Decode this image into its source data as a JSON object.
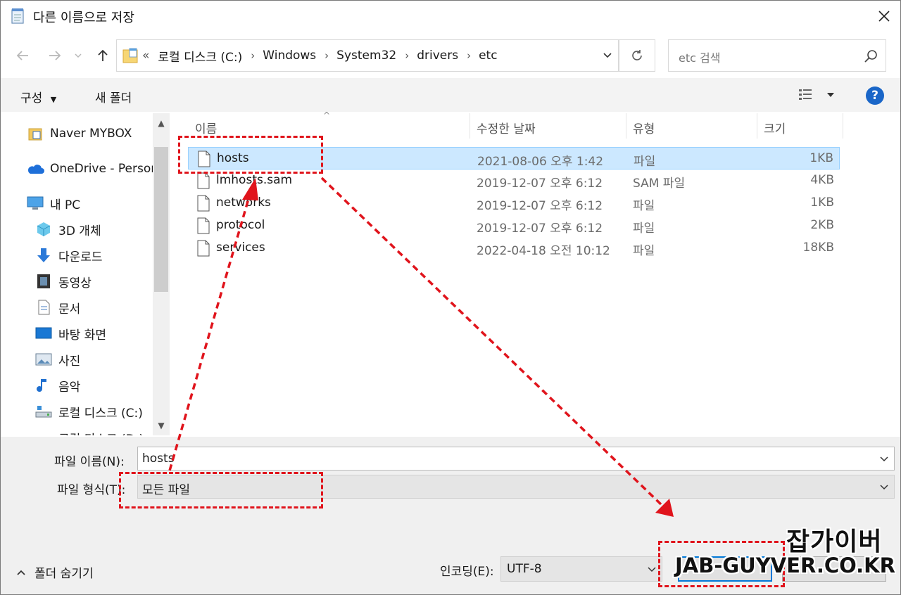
{
  "window": {
    "title": "다른 이름으로 저장"
  },
  "address": {
    "crumbs": [
      "«",
      "로컬 디스크 (C:)",
      "Windows",
      "System32",
      "drivers",
      "etc"
    ]
  },
  "search": {
    "placeholder": "etc 검색"
  },
  "commands": {
    "organize": "구성",
    "new_folder": "새 폴더"
  },
  "nav": {
    "items": [
      {
        "label": "Naver MYBOX",
        "icon": "naver-mybox-icon"
      },
      {
        "label": "OneDrive - Person",
        "icon": "onedrive-cloud-icon"
      },
      {
        "label": "내 PC",
        "icon": "pc-monitor-icon"
      },
      {
        "label": "3D 개체",
        "icon": "3d-object-icon"
      },
      {
        "label": "다운로드",
        "icon": "download-arrow-icon"
      },
      {
        "label": "동영상",
        "icon": "video-film-icon"
      },
      {
        "label": "문서",
        "icon": "document-icon"
      },
      {
        "label": "바탕 화면",
        "icon": "desktop-icon"
      },
      {
        "label": "사진",
        "icon": "picture-icon"
      },
      {
        "label": "음악",
        "icon": "music-note-icon"
      },
      {
        "label": "로컬 디스크 (C:)",
        "icon": "local-disk-icon"
      },
      {
        "label": "로컬 디스크 (D:)",
        "icon": "local-disk-icon"
      }
    ]
  },
  "list": {
    "columns": {
      "name": "이름",
      "date": "수정한 날짜",
      "type": "유형",
      "size": "크기"
    },
    "files": [
      {
        "name": "hosts",
        "date": "2021-08-06 오후 1:42",
        "type": "파일",
        "size": "1KB"
      },
      {
        "name": "lmhosts.sam",
        "date": "2019-12-07 오후 6:12",
        "type": "SAM 파일",
        "size": "4KB"
      },
      {
        "name": "networks",
        "date": "2019-12-07 오후 6:12",
        "type": "파일",
        "size": "1KB"
      },
      {
        "name": "protocol",
        "date": "2019-12-07 오후 6:12",
        "type": "파일",
        "size": "2KB"
      },
      {
        "name": "services",
        "date": "2022-04-18 오전 10:12",
        "type": "파일",
        "size": "18KB"
      }
    ]
  },
  "form": {
    "filename_label": "파일 이름(N):",
    "filename_value": "hosts",
    "filetype_label": "파일 형식(T):",
    "filetype_value": "모든 파일",
    "encoding_label": "인코딩(E):",
    "encoding_value": "UTF-8",
    "hide_folders": "폴더 숨기기"
  },
  "watermark": {
    "line1": "잡가이버",
    "line2": "JAB-GUYVER.CO.KR"
  },
  "colors": {
    "selection": "#cce8ff",
    "annotation": "#e0141c",
    "accent": "#0078d7"
  }
}
